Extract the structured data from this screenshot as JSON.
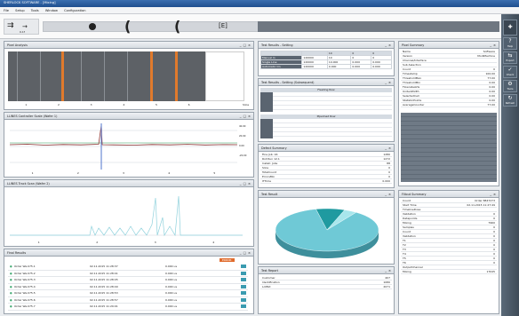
{
  "window": {
    "title": "SHERLOCK SOFTWARE - [Mixing]"
  },
  "menu": [
    "File",
    "Setup",
    "Tools",
    "Window",
    "Configuration"
  ],
  "toolbar": {
    "time_label": "0.1f",
    "cam1": "(",
    "cam2": "(",
    "cam3": "[E]"
  },
  "sidebar": {
    "items": [
      {
        "label": "",
        "icon": "puzzle-icon"
      },
      {
        "label": "Help",
        "icon": "help-icon"
      },
      {
        "label": "Export",
        "icon": "export-icon"
      },
      {
        "label": "Check",
        "icon": "check-icon"
      },
      {
        "label": "Tools",
        "icon": "tools-icon"
      },
      {
        "label": "Refresh",
        "icon": "refresh-icon"
      }
    ]
  },
  "panels": {
    "pixel_analysis": {
      "title": "Pixel Analysis",
      "footer": "Slice",
      "axis": [
        "1",
        "2",
        "3",
        "4",
        "5",
        "6"
      ]
    },
    "line_chart1": {
      "title": "LLINES Controller Scale (Wafer 1)",
      "axis": [
        "1",
        "2",
        "3",
        "4",
        "5"
      ],
      "right_labels": [
        "40.00",
        "20.00",
        "0.00",
        "-20.00"
      ]
    },
    "line_chart2": {
      "title": "LLINES Track Scan (Wafer 2)",
      "axis": [
        "1",
        "2",
        "3",
        "4"
      ]
    },
    "final_results": {
      "title": "Final Results",
      "badge": "ERROR",
      "rows": [
        {
          "name": "Order Wa.075.1",
          "time": "02.11.2015 11:28:37",
          "val": "0.000 us"
        },
        {
          "name": "Order Wa.075.2",
          "time": "02.11.2015 11:28:41",
          "val": "0.000 us"
        },
        {
          "name": "Order Wa.075.3",
          "time": "02.11.2015 11:28:45",
          "val": "0.000 us"
        },
        {
          "name": "Order Wa.075.4",
          "time": "02.11.2015 11:28:49",
          "val": "0.000 us"
        },
        {
          "name": "Order Wa.075.5",
          "time": "02.11.2015 11:28:53",
          "val": "0.000 us"
        },
        {
          "name": "Order Wa.075.6",
          "time": "02.11.2015 11:28:57",
          "val": "0.000 us"
        },
        {
          "name": "Order Wa.075.7",
          "time": "02.11.2015 11:29:01",
          "val": "0.000 us"
        }
      ]
    },
    "test_results_setting": {
      "title": "Test Results - Setting",
      "cols": [
        "",
        "",
        "10",
        "0",
        "0"
      ],
      "rows": [
        {
          "label": "Manual In",
          "c1": "120000",
          "c2": "10",
          "c3": "0",
          "c4": "0"
        },
        {
          "label": "Single Line",
          "c1": "120000",
          "c2": "10.000",
          "c3": "0.000",
          "c4": "0.000"
        },
        {
          "label": "Automatic On",
          "c1": "120000",
          "c2": "0.000",
          "c3": "0.000",
          "c4": "0.000"
        }
      ]
    },
    "test_results_subsequent": {
      "title": "Test Results - Setting (Subsequent)",
      "group1": "Fleeting Row",
      "group2": "Pipelined Row"
    },
    "defect_summary": {
      "title": "Defect Summary",
      "rows": [
        {
          "k": "Fine Job: 16",
          "v": "1280"
        },
        {
          "k": "Roll Run 12.1",
          "v": "1272"
        },
        {
          "k": "Install: Jobs",
          "v": "88"
        },
        {
          "k": "Slice",
          "v": "0"
        },
        {
          "k": "TotalCount",
          "v": "0"
        },
        {
          "k": "ErrorsMin",
          "v": "0"
        },
        {
          "k": "ITTime",
          "v": "0.000"
        }
      ]
    },
    "pie": {
      "title": "Test Result"
    },
    "test_report": {
      "title": "Test Report",
      "rows": [
        {
          "k": "Customer",
          "v": "407"
        },
        {
          "k": "Identification",
          "v": "1080"
        },
        {
          "k": "LotBid",
          "v": "2071"
        }
      ]
    },
    "file_summary": {
      "title": "Pixel Summary",
      "rows": [
        {
          "k": "Name",
          "v": "Software"
        },
        {
          "k": "Version",
          "v": "ModiMachine"
        },
        {
          "k": "Channel/Interface",
          "v": ""
        },
        {
          "k": "Sub-Selection",
          "v": ""
        },
        {
          "k": "Count",
          "v": "0"
        },
        {
          "k": "Timestamp",
          "v": "100.00"
        },
        {
          "k": "ThresholdMax",
          "v": "77.00"
        },
        {
          "k": "ThresholdMin",
          "v": "0.00"
        },
        {
          "k": "FlowrateAVG",
          "v": "0.00"
        },
        {
          "k": "UnitedWidth",
          "v": "0.00"
        },
        {
          "k": "SelectedCell",
          "v": "0.00"
        },
        {
          "k": "StatisticPoints",
          "v": "0.00"
        },
        {
          "k": "AverageCounter",
          "v": "77.00"
        }
      ]
    },
    "fill_summary": {
      "title": "Fillout Summary",
      "rows": [
        {
          "k": "Count",
          "v": "Order 8847273"
        },
        {
          "k": "Start Time",
          "v": "02.11.2015 11:27:49"
        },
        {
          "k": "TimelineDose",
          "v": ""
        },
        {
          "k": "Validation",
          "v": "0"
        },
        {
          "k": "Datapoints",
          "v": "0"
        },
        {
          "k": "Mixing",
          "v": "7960"
        },
        {
          "k": "Samples",
          "v": "0"
        },
        {
          "k": "Count",
          "v": "0"
        },
        {
          "k": "Validation",
          "v": "0"
        },
        {
          "k": "T1",
          "v": "0"
        },
        {
          "k": "T2",
          "v": "0"
        },
        {
          "k": "T3",
          "v": "0"
        },
        {
          "k": "T4",
          "v": "0"
        },
        {
          "k": "T5",
          "v": "0"
        },
        {
          "k": "T6",
          "v": "0"
        },
        {
          "k": "OutputChannel",
          "v": ""
        },
        {
          "k": "Mixing",
          "v": "17045"
        }
      ]
    }
  },
  "chart_data": {
    "type": "pie",
    "values": [
      87,
      9,
      4
    ],
    "colors": [
      "#6fc9d6",
      "#1f9aa0",
      "#a8e6ec"
    ]
  }
}
